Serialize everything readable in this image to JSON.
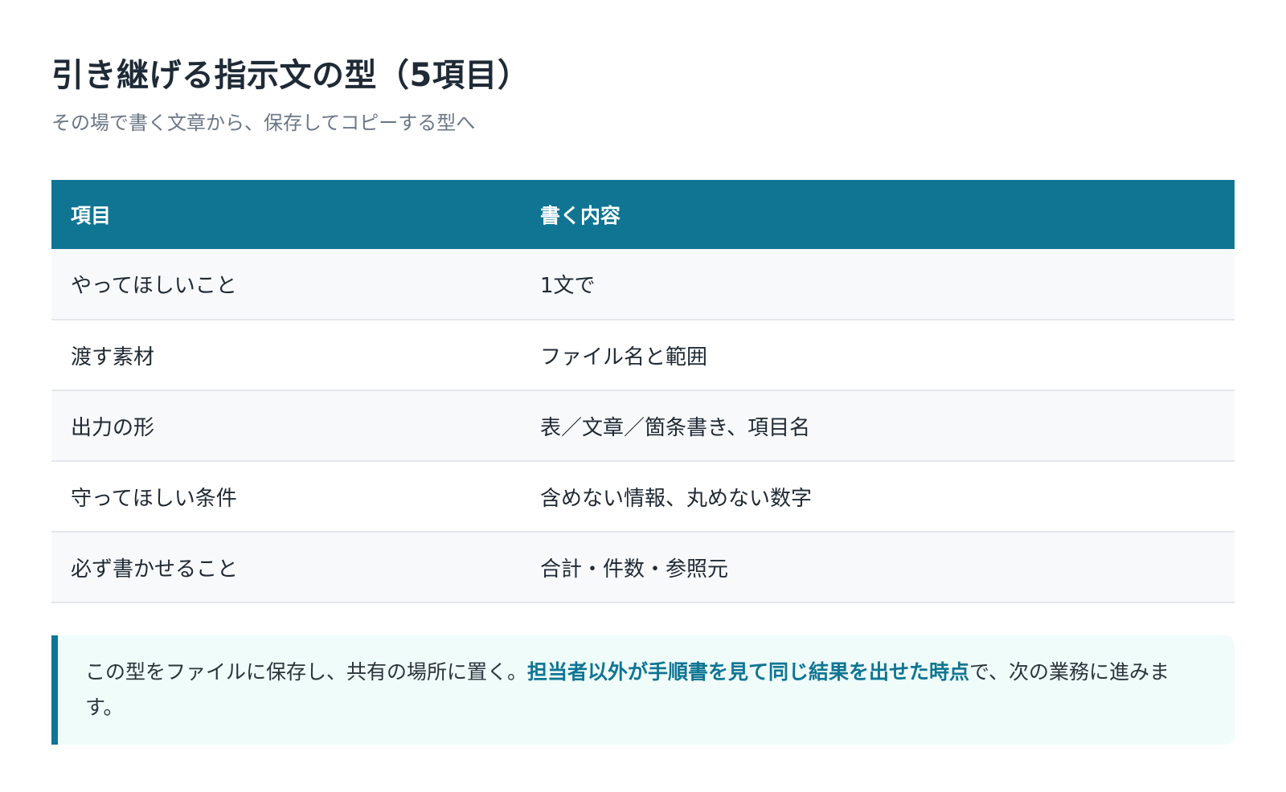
{
  "header": {
    "title": "引き継げる指示文の型（5項目）",
    "subtitle": "その場で書く文章から、保存してコピーする型へ"
  },
  "table": {
    "columns": [
      "項目",
      "書く内容"
    ],
    "rows": [
      [
        "やってほしいこと",
        "1文で"
      ],
      [
        "渡す素材",
        "ファイル名と範囲"
      ],
      [
        "出力の形",
        "表／文章／箇条書き、項目名"
      ],
      [
        "守ってほしい条件",
        "含めない情報、丸めない数字"
      ],
      [
        "必ず書かせること",
        "合計・件数・参照元"
      ]
    ]
  },
  "note": {
    "before": "この型をファイルに保存し、共有の場所に置く。",
    "emphasis": "担当者以外が手順書を見て同じ結果を出せた時点",
    "after": "で、次の業務に進みます。"
  },
  "colors": {
    "accent": "#107593",
    "note_background": "#effcfa"
  }
}
